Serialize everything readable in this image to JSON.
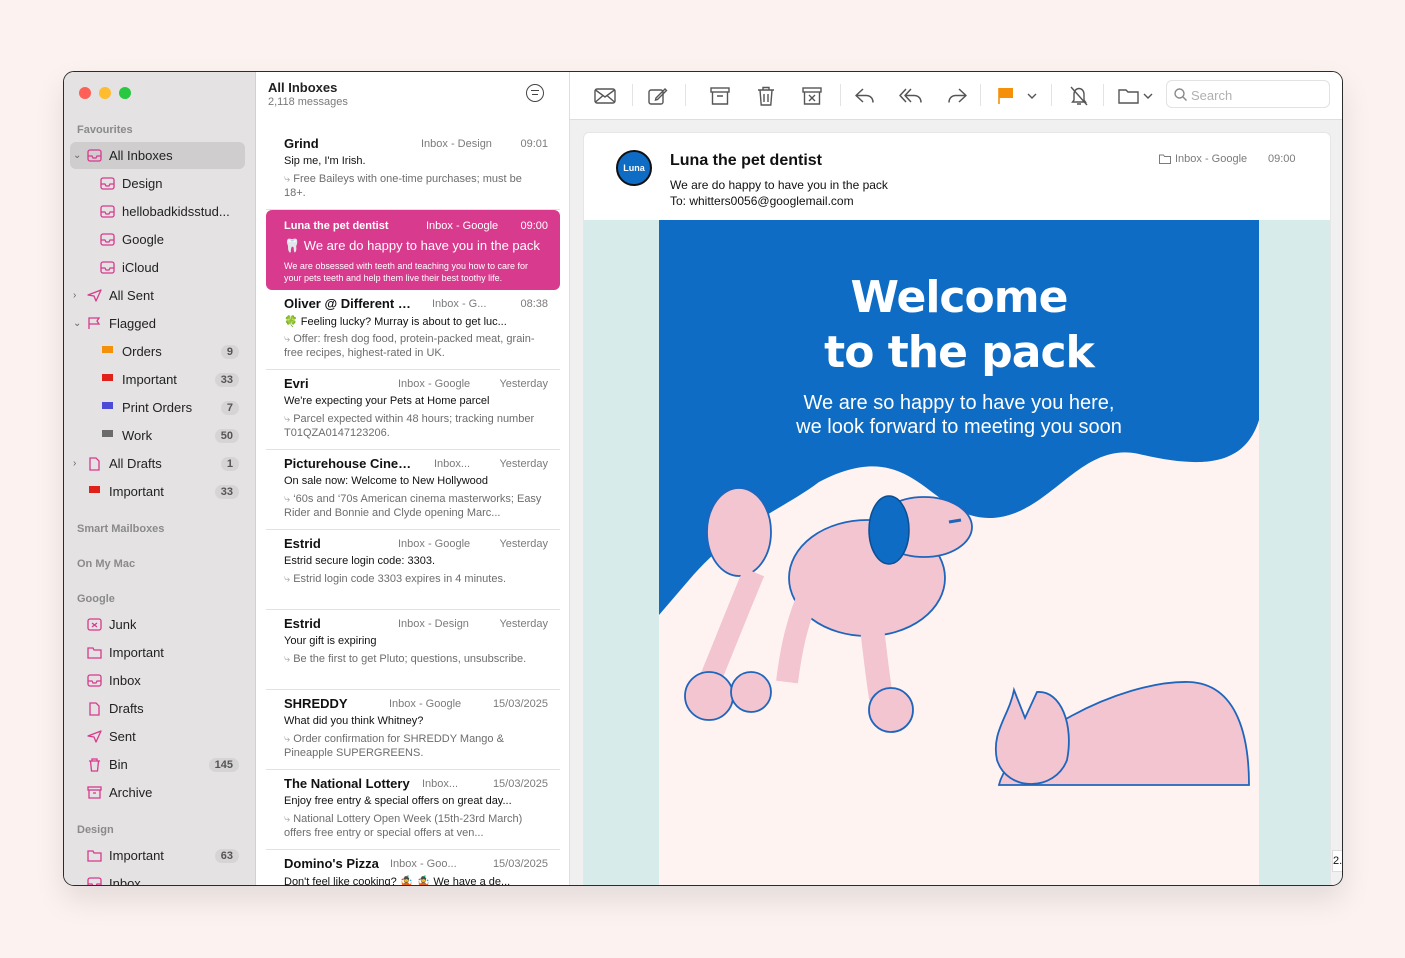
{
  "sidebar": {
    "sections": {
      "favourites": "Favourites",
      "smart": "Smart Mailboxes",
      "onmymac": "On My Mac",
      "google": "Google",
      "design": "Design"
    },
    "items": [
      {
        "label": "All Inboxes"
      },
      {
        "label": "Design"
      },
      {
        "label": "hellobadkidsstud..."
      },
      {
        "label": "Google"
      },
      {
        "label": "iCloud"
      },
      {
        "label": "All Sent"
      },
      {
        "label": "Flagged"
      },
      {
        "label": "Orders",
        "count": "9"
      },
      {
        "label": "Important",
        "count": "33"
      },
      {
        "label": "Print Orders",
        "count": "7"
      },
      {
        "label": "Work",
        "count": "50"
      },
      {
        "label": "All Drafts",
        "count": "1"
      },
      {
        "label": "Important",
        "count": "33"
      },
      {
        "label": "Junk"
      },
      {
        "label": "Important"
      },
      {
        "label": "Inbox"
      },
      {
        "label": "Drafts"
      },
      {
        "label": "Sent"
      },
      {
        "label": "Bin",
        "count": "145"
      },
      {
        "label": "Archive"
      },
      {
        "label": "Important",
        "count": "63"
      },
      {
        "label": "Inbox"
      }
    ]
  },
  "list": {
    "title": "All Inboxes",
    "count": "2,118 messages",
    "messages": [
      {
        "sender": "Grind",
        "mailbox": "Inbox - Design",
        "time": "09:01",
        "subject": "Sip me, I'm Irish.",
        "preview": "Free Baileys with one-time purchases; must be 18+."
      },
      {
        "sender": "Luna the pet dentist",
        "mailbox": "Inbox - Google",
        "time": "09:00",
        "subject": "🦷 We are do happy to have you in the pack",
        "preview": "We are obsessed with teeth and teaching you how to care for your pets teeth and help them live their best toothy life."
      },
      {
        "sender": "Oliver @ Different Dog",
        "mailbox": "Inbox - G...",
        "time": "08:38",
        "subject": "🍀 Feeling lucky? Murray is about to get luc...",
        "preview": "Offer: fresh dog food, protein-packed meat, grain-free recipes, highest-rated in UK."
      },
      {
        "sender": "Evri",
        "mailbox": "Inbox - Google",
        "time": "Yesterday",
        "subject": "We're expecting your Pets at Home parcel",
        "preview": "Parcel expected within 48 hours; tracking number T01QZA0147123206."
      },
      {
        "sender": "Picturehouse Cinemas",
        "mailbox": "Inbox...",
        "time": "Yesterday",
        "subject": "On sale now: Welcome to New Hollywood",
        "preview": "‘60s and ‘70s American cinema masterworks; Easy Rider and Bonnie and Clyde opening Marc..."
      },
      {
        "sender": "Estrid",
        "mailbox": "Inbox - Google",
        "time": "Yesterday",
        "subject": "Estrid secure login code: 3303.",
        "preview": "Estrid login code 3303 expires in 4 minutes."
      },
      {
        "sender": "Estrid",
        "mailbox": "Inbox - Design",
        "time": "Yesterday",
        "subject": "Your gift is expiring",
        "preview": "Be the first to get Pluto; questions, unsubscribe."
      },
      {
        "sender": "SHREDDY",
        "mailbox": "Inbox - Google",
        "time": "15/03/2025",
        "subject": "What did you think Whitney?",
        "preview": "Order confirmation for SHREDDY Mango & Pineapple SUPERGREENS."
      },
      {
        "sender": "The National Lottery",
        "mailbox": "Inbox...",
        "time": "15/03/2025",
        "subject": "Enjoy free entry & special offers on great day...",
        "preview": "National Lottery Open Week (15th-23rd March) offers free entry or special offers at ven..."
      },
      {
        "sender": "Domino's Pizza",
        "mailbox": "Inbox - Goo...",
        "time": "15/03/2025",
        "subject": "Don't feel like cooking? 🤹 🤹 We have a de...",
        "preview": ""
      }
    ]
  },
  "toolbar": {
    "search_placeholder": "Search"
  },
  "email": {
    "avatar_text": "Luna",
    "from": "Luna the pet dentist",
    "subject": "We are do happy to have you in the pack",
    "to": "To: whitters0056@googlemail.com",
    "mailbox": "Inbox - Google",
    "time": "09:00",
    "banner_title_1": "Welcome",
    "banner_title_2": "to the pack",
    "banner_text_1": "We are so happy to have you here,",
    "banner_text_2": "we look forward to meeting you soon",
    "side_peek": "2."
  },
  "colors": {
    "accent_pink": "#d83a8e",
    "brand_blue": "#0e6cc4",
    "banner_bg": "#fff3f2",
    "mint": "#d7ecea",
    "flag_orange": "#f5900b"
  }
}
